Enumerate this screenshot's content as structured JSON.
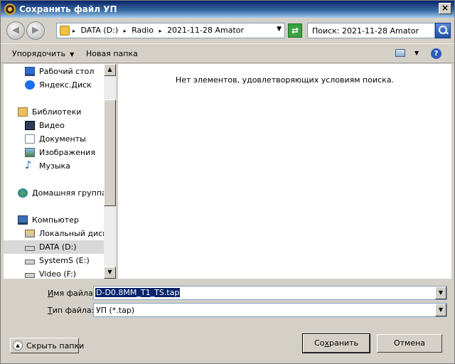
{
  "window": {
    "title": "Сохранить файл УП"
  },
  "nav": {
    "back_glyph": "◀",
    "forward_glyph": "▶"
  },
  "address": {
    "crumbs": [
      "DATA (D:)",
      "Radio",
      "2021-11-28 Amator"
    ],
    "separator": "▸",
    "dropdown_glyph": "▼"
  },
  "refresh": {
    "glyph": "⇄"
  },
  "search": {
    "text": "Поиск: 2021-11-28 Amator"
  },
  "toolbar": {
    "organize_label": "Упорядочить",
    "arrow_glyph": "▼",
    "new_folder_label": "Новая папка",
    "help_glyph": "?"
  },
  "sidebar": {
    "items": [
      {
        "label": "Рабочий стол",
        "icon": "desktop-icon"
      },
      {
        "label": "Яндекс.Диск",
        "icon": "yandex-disk-icon"
      },
      {
        "label": "Библиотеки",
        "icon": "libraries-icon"
      },
      {
        "label": "Видео",
        "icon": "video-icon"
      },
      {
        "label": "Документы",
        "icon": "documents-icon"
      },
      {
        "label": "Изображения",
        "icon": "images-icon"
      },
      {
        "label": "Музыка",
        "icon": "music-icon"
      },
      {
        "label": "Домашняя группа",
        "icon": "homegroup-icon"
      },
      {
        "label": "Компьютер",
        "icon": "computer-icon"
      },
      {
        "label": "Локальный диск (",
        "icon": "system-disk-icon"
      },
      {
        "label": "DATA (D:)",
        "icon": "disk-icon"
      },
      {
        "label": "SystemS (E:)",
        "icon": "disk-icon"
      },
      {
        "label": "Video (F:)",
        "icon": "disk-icon"
      }
    ],
    "scroll_up_glyph": "▲",
    "scroll_down_glyph": "▼"
  },
  "content": {
    "empty_message": "Нет элементов, удовлетворяющих условиям поиска."
  },
  "fields": {
    "filename_label_u": "И",
    "filename_label_rest": "мя файла:",
    "filename_value": "D-D0.8MM_T1_TS.tap",
    "filetype_label_u": "Т",
    "filetype_label_rest": "ип файла:",
    "filetype_value": "УП (*.tap)",
    "combo_glyph": "▼"
  },
  "buttons": {
    "hide_folders_icon": "▲",
    "hide_folders": "Скрыть папки",
    "save_pre": "Со",
    "save_u": "х",
    "save_post": "ранить",
    "cancel": "Отмена"
  },
  "colors": {
    "title_bar": "#0a246a",
    "selection": "#0a246a"
  }
}
